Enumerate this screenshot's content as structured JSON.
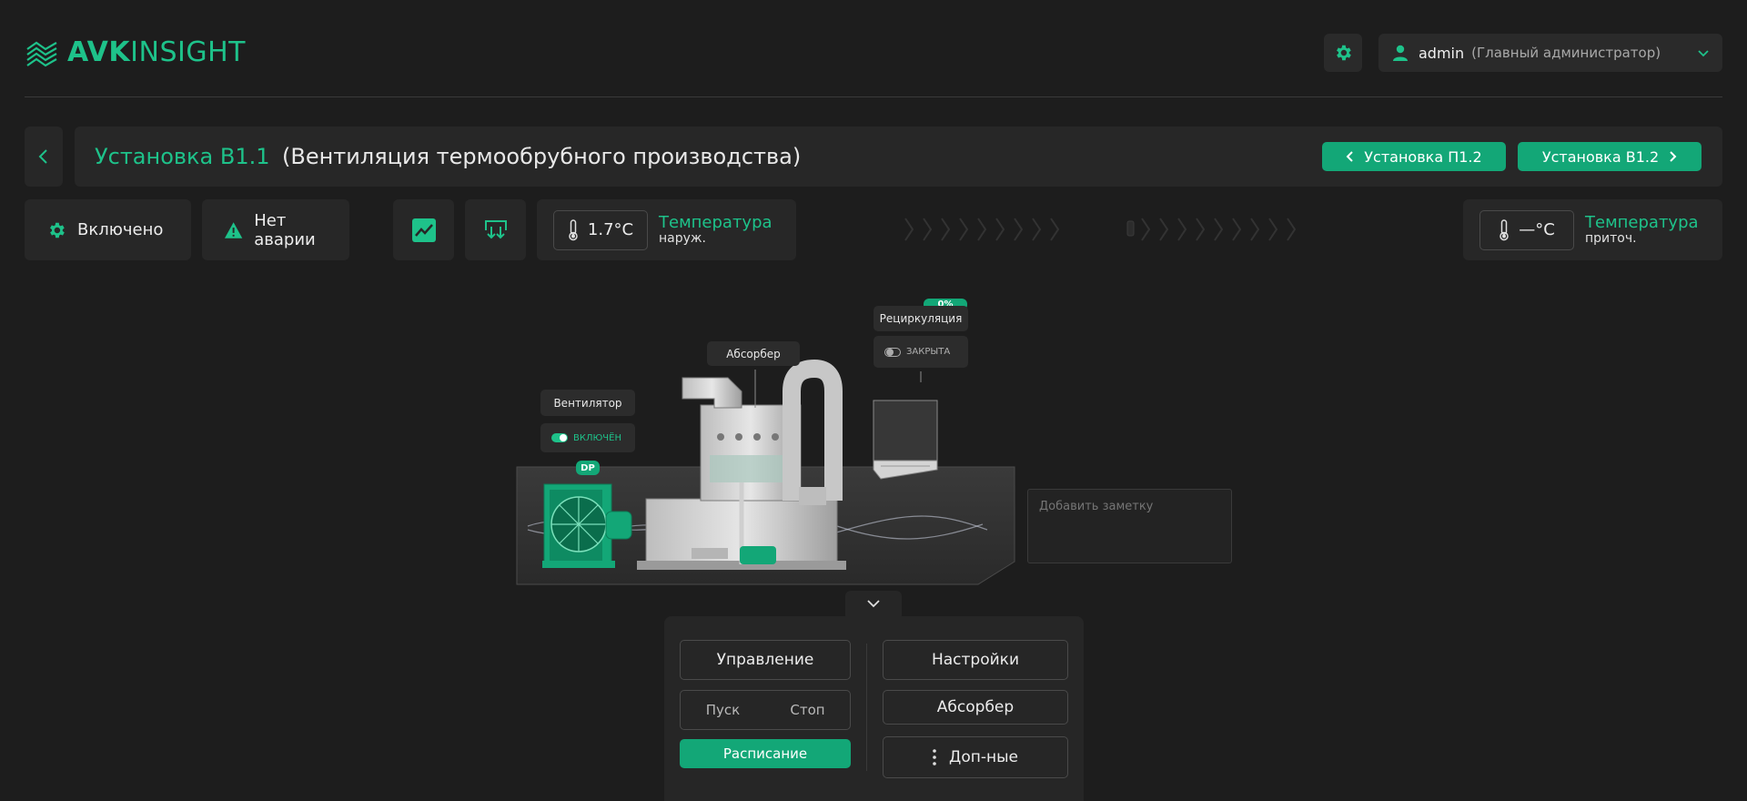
{
  "header": {
    "logo_bold": "AVK",
    "logo_light": "INSIGHT",
    "user_name": "admin",
    "user_role": "(Главный администратор)",
    "icons": [
      "waves-logo-icon",
      "gear-icon",
      "user-icon",
      "chevron-down-icon"
    ]
  },
  "unit": {
    "title": "Установка В1.1",
    "description": "(Вентиляция термообрубного производства)",
    "prev_label": "Установка П1.2",
    "next_label": "Установка В1.2"
  },
  "status": {
    "power": "Включено",
    "alarm": "Нет аварии",
    "outdoor_temp": "1.7°C",
    "outdoor_temp_l1": "Температура",
    "outdoor_temp_l2": "наруж.",
    "supply_temp": "—°C",
    "supply_temp_l1": "Температура",
    "supply_temp_l2": "приточ."
  },
  "scheme": {
    "absorber_label": "Абсорбер",
    "fan_label": "Вентилятор",
    "fan_state": "ВКЛЮЧЁН",
    "fan_badge": "DP",
    "recirc_label": "Рециркуляция",
    "recirc_percent": "0%",
    "recirc_state": "ЗАКРЫТА",
    "note_placeholder": "Добавить заметку"
  },
  "controls": {
    "control_label": "Управление",
    "start_label": "Пуск",
    "stop_label": "Стоп",
    "schedule_label": "Расписание",
    "settings_label": "Настройки",
    "absorber_label": "Абсорбер",
    "more_label": "Доп-ные"
  },
  "colors": {
    "accent": "#1ec28a",
    "button": "#13a777",
    "background": "#1d1d1d",
    "panel": "#272727"
  }
}
